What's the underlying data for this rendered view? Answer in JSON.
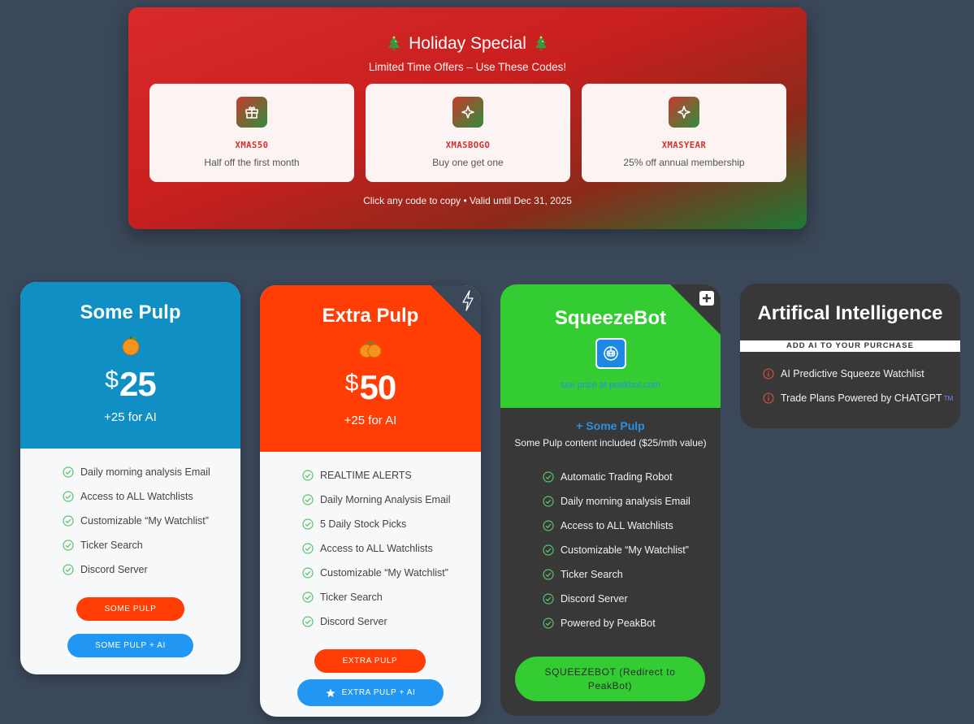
{
  "holiday": {
    "title": "Holiday Special",
    "subtitle": "Limited Time Offers – Use These Codes!",
    "footer": "Click any code to copy • Valid until Dec 31, 2025",
    "codes": [
      {
        "code": "XMAS50",
        "desc": "Half off the first month",
        "icon": "gift-icon"
      },
      {
        "code": "XMASBOGO",
        "desc": "Buy one get one",
        "icon": "sparkle-icon"
      },
      {
        "code": "XMASYEAR",
        "desc": "25% off annual membership",
        "icon": "sparkle-icon"
      }
    ]
  },
  "plans": {
    "some_pulp": {
      "title": "Some Pulp",
      "currency": "$",
      "price": "25",
      "ai_extra": "+25 for AI",
      "features": [
        "Daily morning analysis Email",
        "Access to ALL Watchlists",
        "Customizable “My Watchlist”",
        "Ticker Search",
        "Discord Server"
      ],
      "btn_primary": "SOME PULP",
      "btn_ai": "SOME PULP + AI",
      "color": "#0f8fc4"
    },
    "extra_pulp": {
      "title": "Extra Pulp",
      "currency": "$",
      "price": "50",
      "ai_extra": "+25 for AI",
      "features": [
        "REALTIME ALERTS",
        "Daily Morning Analysis Email",
        "5 Daily Stock Picks",
        "Access to ALL Watchlists",
        "Customizable “My Watchlist”",
        "Ticker Search",
        "Discord Server"
      ],
      "btn_primary": "EXTRA PULP",
      "btn_ai": "EXTRA PULP + AI",
      "corner_icon": "lightning-icon",
      "color": "#ff3d05"
    },
    "squeezebot": {
      "title": "SqueezeBot",
      "price_link": "see price at peakbot.com",
      "plus_title": "+ Some Pulp",
      "plus_sub": "Some Pulp content included ($25/mth value)",
      "features": [
        "Automatic Trading Robot",
        "Daily morning analysis Email",
        "Access to ALL Watchlists",
        "Customizable “My Watchlist”",
        "Ticker Search",
        "Discord Server",
        "Powered by PeakBot"
      ],
      "btn_primary": "SQUEEZEBOT (Redirect to PeakBot)",
      "corner_icon": "plus-square-icon",
      "color": "#33cc33"
    },
    "ai": {
      "title": "Artifical Intelligence",
      "bar": "ADD AI TO YOUR PURCHASE",
      "features": [
        "AI Predictive Squeeze Watchlist",
        "Trade Plans Powered by CHATGPT"
      ],
      "tm": "TM"
    }
  }
}
